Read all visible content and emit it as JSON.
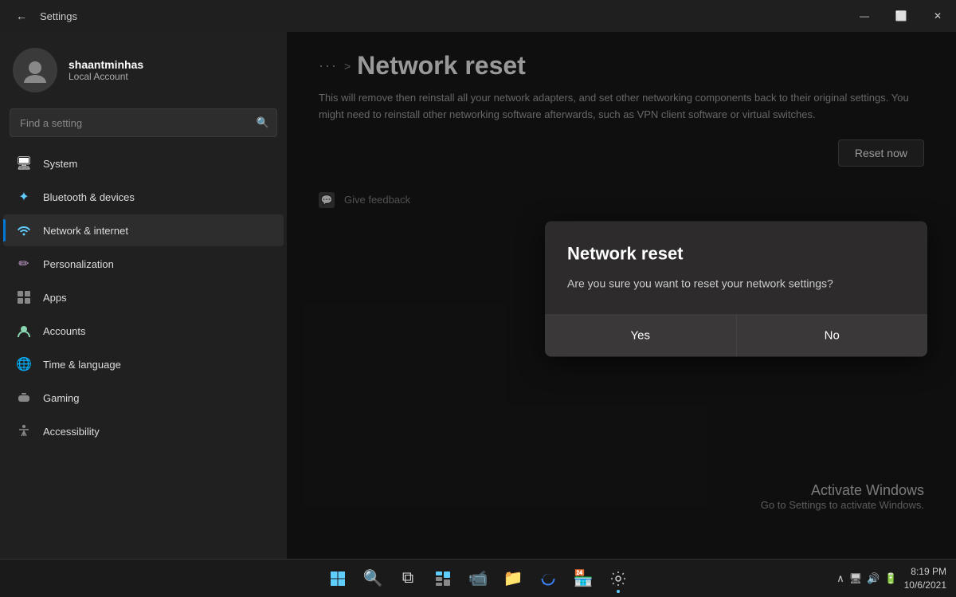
{
  "titlebar": {
    "back_label": "←",
    "title": "Settings",
    "minimize": "—",
    "maximize": "⬜",
    "close": "✕"
  },
  "sidebar": {
    "search_placeholder": "Find a setting",
    "user": {
      "name": "shaantminhas",
      "account_type": "Local Account"
    },
    "items": [
      {
        "id": "system",
        "label": "System",
        "icon": "🖥",
        "active": false
      },
      {
        "id": "bluetooth",
        "label": "Bluetooth & devices",
        "icon": "✦",
        "active": false
      },
      {
        "id": "network",
        "label": "Network & internet",
        "icon": "📶",
        "active": true
      },
      {
        "id": "personalization",
        "label": "Personalization",
        "icon": "✏",
        "active": false
      },
      {
        "id": "apps",
        "label": "Apps",
        "icon": "🧩",
        "active": false
      },
      {
        "id": "accounts",
        "label": "Accounts",
        "icon": "👤",
        "active": false
      },
      {
        "id": "time",
        "label": "Time & language",
        "icon": "🌐",
        "active": false
      },
      {
        "id": "gaming",
        "label": "Gaming",
        "icon": "🎮",
        "active": false
      },
      {
        "id": "accessibility",
        "label": "Accessibility",
        "icon": "♿",
        "active": false
      }
    ]
  },
  "content": {
    "breadcrumb_dots": "···",
    "breadcrumb_chevron": ">",
    "page_title": "Network reset",
    "description": "This will remove then reinstall all your network adapters, and set other networking components back to their original settings. You might need to reinstall other networking software afterwards, such as VPN client software or virtual switches.",
    "reset_now_label": "Reset now",
    "give_feedback_label": "Give feedback",
    "activate_title": "Activate Windows",
    "activate_sub": "Go to Settings to activate Windows."
  },
  "dialog": {
    "title": "Network reset",
    "message": "Are you sure you want to reset your network settings?",
    "yes_label": "Yes",
    "no_label": "No"
  },
  "taskbar": {
    "time": "8:19 PM",
    "date": "10/6/2021",
    "icons": [
      "⊞",
      "🔍",
      "⧉",
      "▦",
      "📹",
      "📁",
      "🌐",
      "🏪",
      "⚙"
    ]
  }
}
